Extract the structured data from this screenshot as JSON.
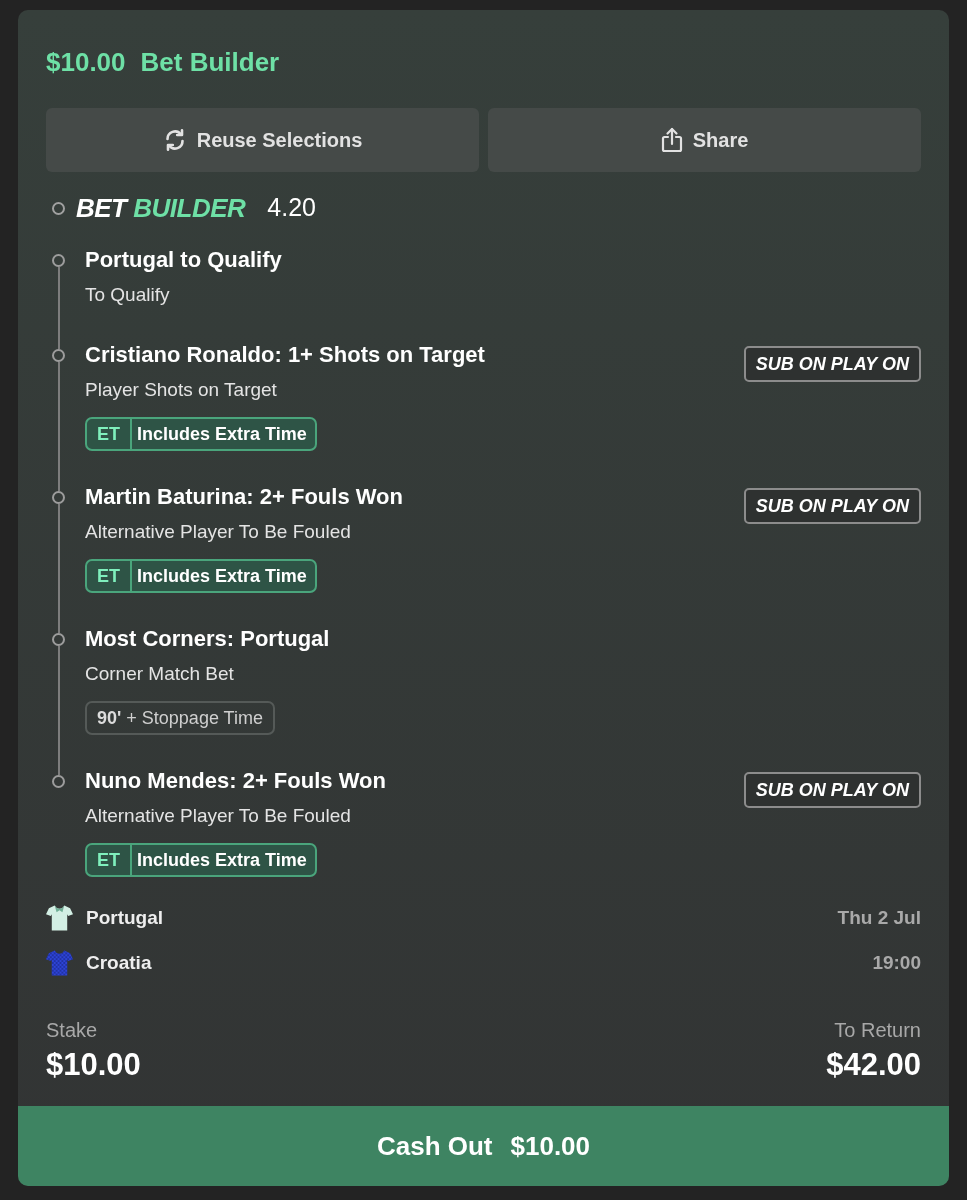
{
  "header": {
    "amount": "$10.00",
    "title": "Bet Builder"
  },
  "actions": [
    {
      "kind": "reuse",
      "label": "Reuse Selections"
    },
    {
      "kind": "share",
      "label": "Share"
    }
  ],
  "bet_builder": {
    "logo": [
      "BET",
      "BUILDER"
    ],
    "odds": "4.20"
  },
  "legs": [
    {
      "title": "Portugal to Qualify",
      "market": "To Qualify"
    },
    {
      "title": "Cristiano Ronaldo: 1+ Shots on Target",
      "market": "Player Shots on Target",
      "badge": "SUB ON PLAY ON",
      "tag": {
        "kind": "extra_time",
        "code": "ET",
        "text": "Includes Extra Time"
      }
    },
    {
      "title": "Martin Baturina: 2+ Fouls Won",
      "market": "Alternative Player To Be Fouled",
      "badge": "SUB ON PLAY ON",
      "tag": {
        "kind": "extra_time",
        "code": "ET",
        "text": "Includes Extra Time"
      }
    },
    {
      "title": "Most Corners: Portugal",
      "market": "Corner Match Bet",
      "tag": {
        "kind": "regular_time",
        "code": "90'",
        "text": "+ Stoppage Time"
      }
    },
    {
      "title": "Nuno Mendes: 2+ Fouls Won",
      "market": "Alternative Player To Be Fouled",
      "badge": "SUB ON PLAY ON",
      "tag": {
        "kind": "extra_time",
        "code": "ET",
        "text": "Includes Extra Time"
      }
    }
  ],
  "event": {
    "teams": [
      {
        "name": "Portugal",
        "kind": "plain",
        "color": "#d3efe4"
      },
      {
        "name": "Croatia",
        "kind": "checkered",
        "color": "#2d44d8"
      }
    ],
    "date": "Thu 2 Jul",
    "time": "19:00"
  },
  "stake": {
    "label": "Stake",
    "value": "$10.00"
  },
  "returns": {
    "label": "To Return",
    "value": "$42.00"
  },
  "cash_out": {
    "label": "Cash Out",
    "amount": "$10.00"
  }
}
